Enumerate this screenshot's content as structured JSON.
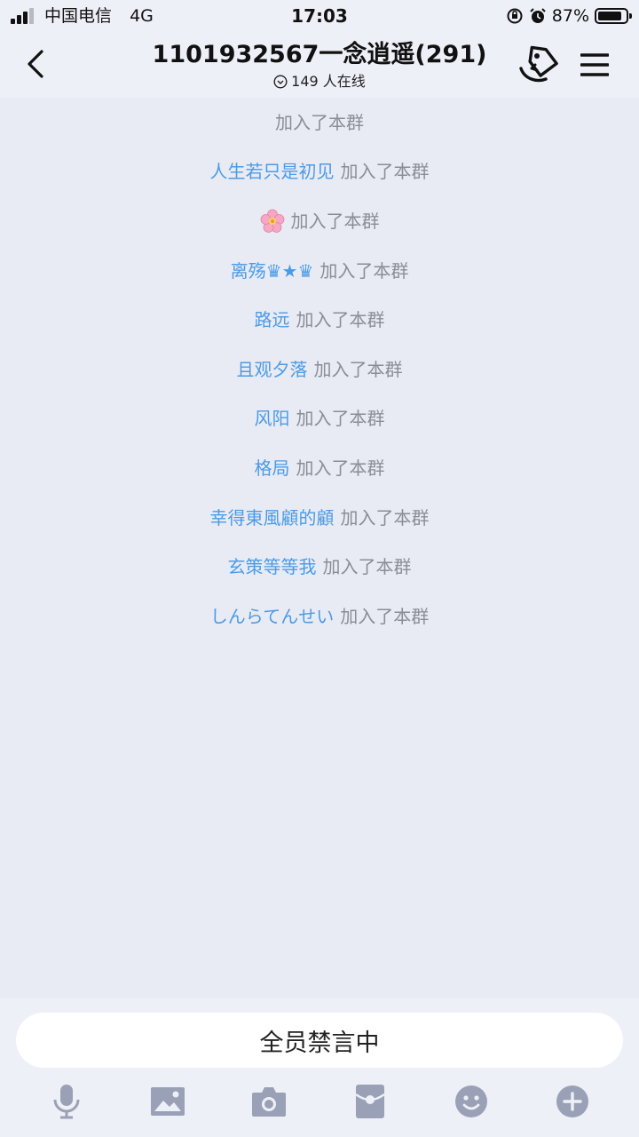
{
  "status_bar": {
    "carrier": "中国电信",
    "network": "4G",
    "time": "17:03",
    "battery_percent": "87%",
    "battery_level": 0.87
  },
  "header": {
    "title": "1101932567一念逍遥(291)",
    "online_text": "149 人在线"
  },
  "messages": [
    {
      "user": "",
      "action": "加入了本群"
    },
    {
      "user": "人生若只是初见",
      "action": "加入了本群"
    },
    {
      "user": "",
      "icon": "cherry-blossom-icon",
      "action": "加入了本群"
    },
    {
      "user": "离殇♛★♛",
      "action": "加入了本群"
    },
    {
      "user": "路远",
      "action": "加入了本群"
    },
    {
      "user": "且观夕落",
      "action": "加入了本群"
    },
    {
      "user": "风阳",
      "action": "加入了本群"
    },
    {
      "user": "格局",
      "action": "加入了本群"
    },
    {
      "user": "幸得東風顧的顧",
      "action": "加入了本群"
    },
    {
      "user": "玄策等等我",
      "action": "加入了本群"
    },
    {
      "user": "しんらてんせい",
      "action": "加入了本群"
    }
  ],
  "mute_notice": "全员禁言中",
  "toolbar": [
    "microphone-icon",
    "image-icon",
    "camera-icon",
    "red-packet-icon",
    "emoji-icon",
    "plus-icon"
  ],
  "colors": {
    "background": "#e9ebf4",
    "username": "#4a9be6",
    "system_text": "#8a8d96",
    "toolbar_icon": "#9aa1b6"
  }
}
